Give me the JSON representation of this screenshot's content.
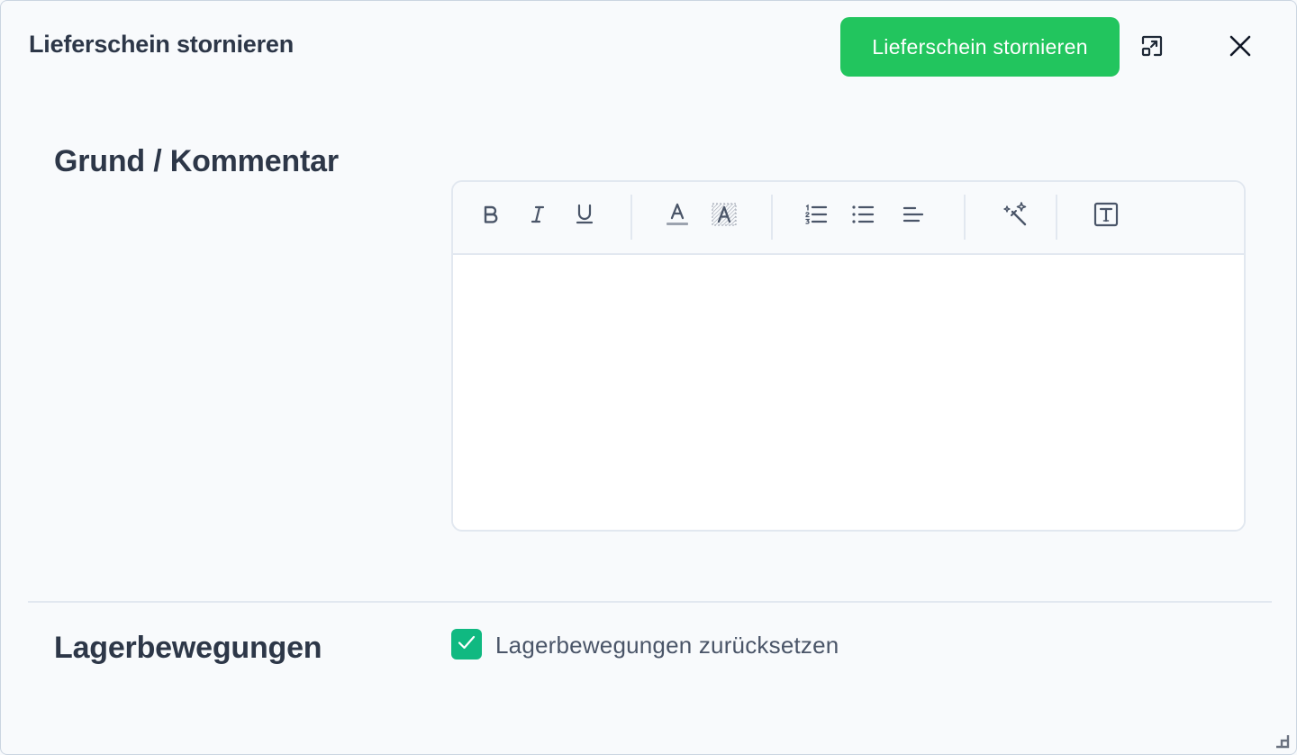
{
  "dialog": {
    "title": "Lieferschein stornieren",
    "primary_button_label": "Lieferschein stornieren",
    "accent_color": "#22c55e",
    "checkbox_color": "#10b981"
  },
  "icons": {
    "expand": "expand-icon",
    "close": "close-icon"
  },
  "sections": {
    "grund_label": "Grund / Kommentar",
    "lager_label": "Lagerbewegungen"
  },
  "editor": {
    "content": "",
    "toolbar": [
      {
        "name": "bold",
        "icon": "bold-icon"
      },
      {
        "name": "italic",
        "icon": "italic-icon"
      },
      {
        "name": "underline",
        "icon": "underline-icon"
      },
      {
        "name": "text-color",
        "icon": "text-color-icon"
      },
      {
        "name": "highlight",
        "icon": "highlight-icon"
      },
      {
        "name": "ordered-list",
        "icon": "ordered-list-icon"
      },
      {
        "name": "bullet-list",
        "icon": "bullet-list-icon"
      },
      {
        "name": "align",
        "icon": "align-left-icon"
      },
      {
        "name": "magic",
        "icon": "magic-wand-icon"
      },
      {
        "name": "text-template",
        "icon": "text-box-icon"
      }
    ]
  },
  "lager": {
    "checkbox_label": "Lagerbewegungen zurücksetzen",
    "checked": true
  }
}
